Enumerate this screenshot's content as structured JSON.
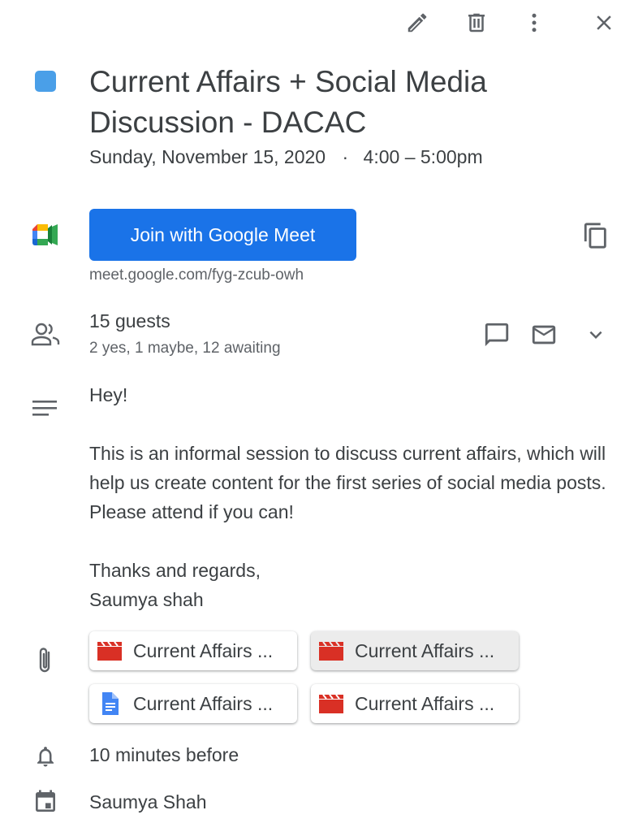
{
  "toolbar": {
    "edit_icon": "pencil-icon",
    "delete_icon": "trash-icon",
    "more_icon": "more-vert-icon",
    "close_icon": "close-icon"
  },
  "event": {
    "color": "#4a9fe8",
    "title": "Current Affairs + Social Media Discussion - DACAC",
    "date": "Sunday, November 15, 2020",
    "separator": "·",
    "time": "4:00 – 5:00pm"
  },
  "meet": {
    "button_label": "Join with Google Meet",
    "link": "meet.google.com/fyg-zcub-owh",
    "button_color": "#1a73e8"
  },
  "guests": {
    "count": "15 guests",
    "summary": "2 yes, 1 maybe, 12 awaiting"
  },
  "description": {
    "greeting": "Hey!",
    "body": "This is an informal session to discuss current affairs, which will help us create content for the first series of social media posts. Please attend if you can!",
    "closing": "Thanks and regards,",
    "signature": "Saumya shah"
  },
  "attachments": [
    {
      "label": "Current Affairs ...",
      "icon": "video-file-icon"
    },
    {
      "label": "Current Affairs ...",
      "icon": "video-file-icon"
    },
    {
      "label": "Current Affairs ...",
      "icon": "document-icon"
    },
    {
      "label": "Current Affairs ...",
      "icon": "video-file-icon"
    }
  ],
  "reminder": "10 minutes before",
  "calendar_owner": "Saumya Shah"
}
